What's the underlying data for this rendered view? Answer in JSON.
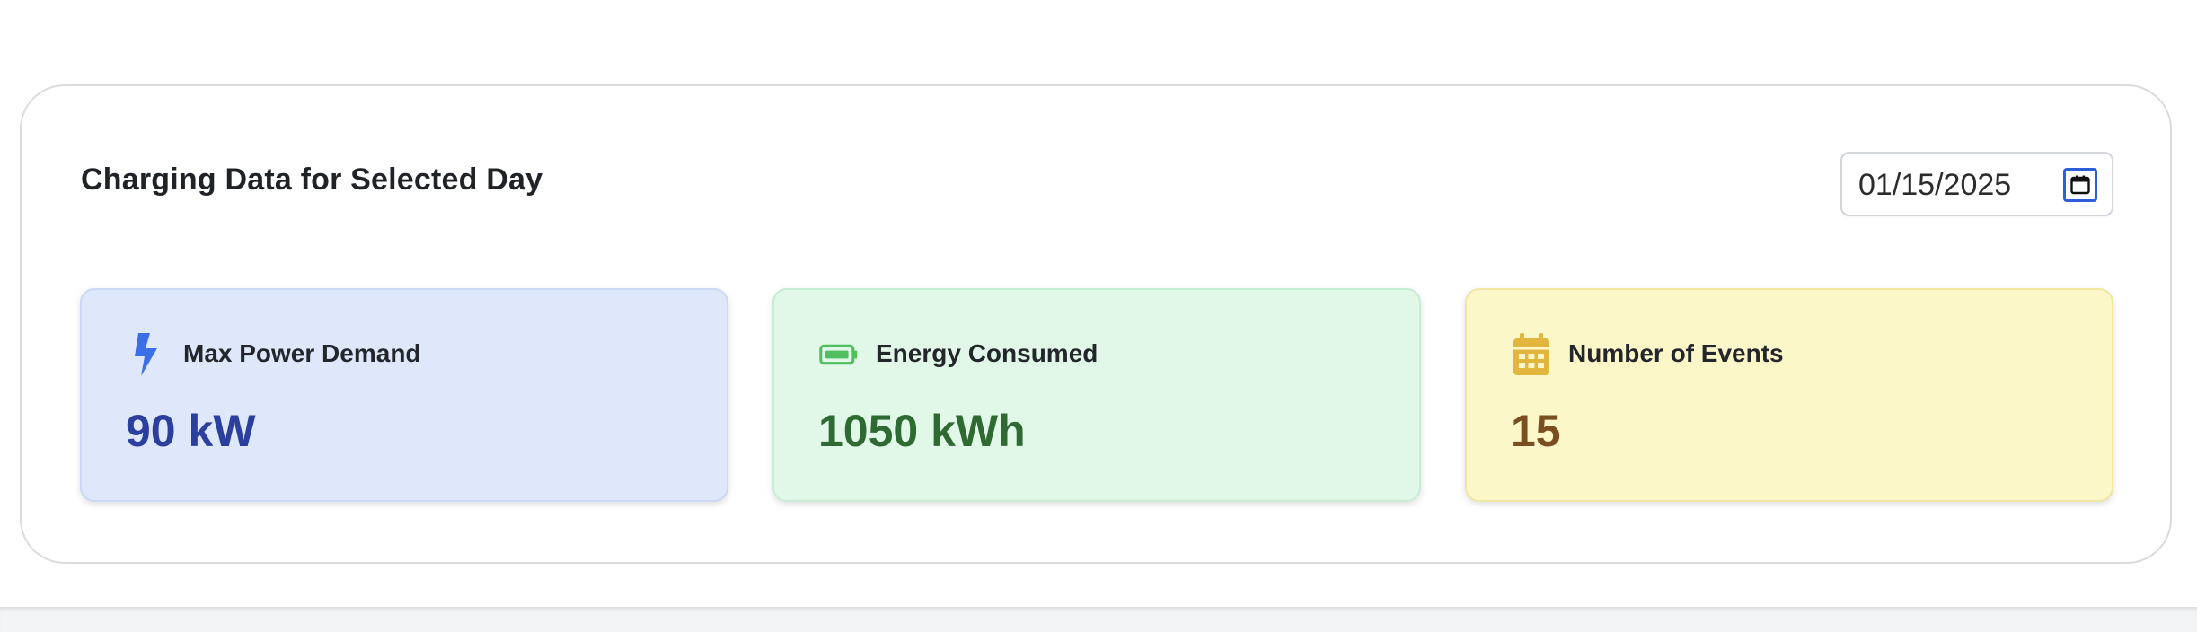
{
  "panel": {
    "title": "Charging Data for Selected Day",
    "date_input": {
      "value": "01/15/2025",
      "icon": "calendar-icon"
    }
  },
  "cards": [
    {
      "label": "Max Power Demand",
      "value": "90 kW",
      "icon": "lightning-bolt-icon",
      "color": "#3b6fe8"
    },
    {
      "label": "Energy Consumed",
      "value": "1050 kWh",
      "icon": "battery-icon",
      "color": "#4fbf5f"
    },
    {
      "label": "Number of Events",
      "value": "15",
      "icon": "calendar-icon",
      "color": "#e2b53f"
    }
  ]
}
